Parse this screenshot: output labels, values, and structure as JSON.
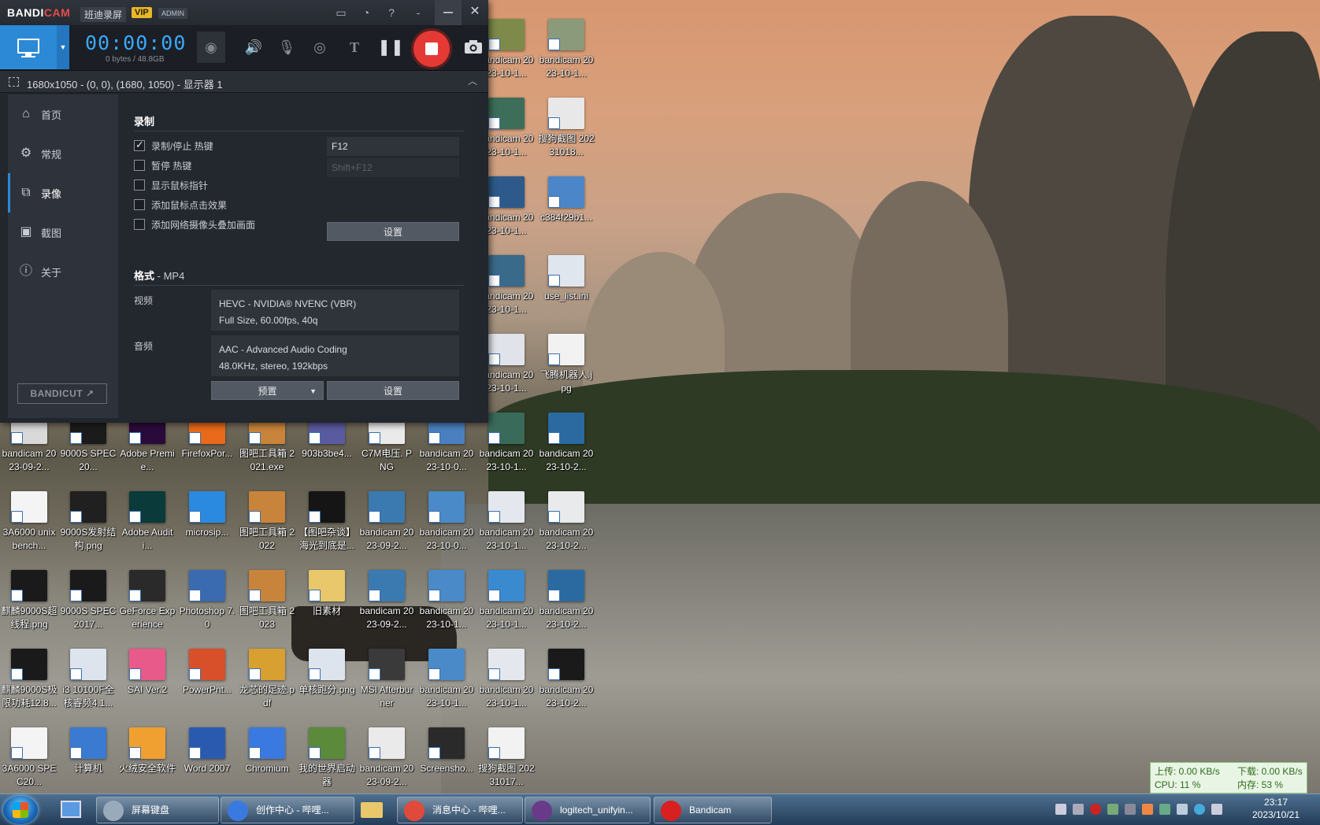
{
  "bandicam": {
    "logo_band": "BANDI",
    "logo_cam": "CAM",
    "brand_cn": "班迪录屏",
    "vip": "VIP",
    "admin": "ADMIN",
    "timer": "00:00:00",
    "bytes": "0 bytes / 48.8GB",
    "area": "1680x1050 - (0, 0), (1680, 1050) - 显示器 1",
    "sidebar": [
      "首页",
      "常规",
      "录像",
      "截图",
      "关于"
    ],
    "bandicut": "BANDICUT ↗",
    "record": {
      "title": "录制",
      "options": [
        {
          "label": "录制/停止 热键",
          "checked": true
        },
        {
          "label": "暂停 热键",
          "checked": false
        },
        {
          "label": "显示鼠标指针",
          "checked": false
        },
        {
          "label": "添加鼠标点击效果",
          "checked": false
        },
        {
          "label": "添加网络摄像头叠加画面",
          "checked": false
        }
      ],
      "hotkey_record": "F12",
      "hotkey_pause": "Shift+F12",
      "settings_btn": "设置"
    },
    "format": {
      "title": "格式",
      "container": " - MP4",
      "video_label": "视频",
      "video_line1": "HEVC - NVIDIA® NVENC (VBR)",
      "video_line2": "Full Size, 60.00fps, 40q",
      "audio_label": "音频",
      "audio_line1": "AAC - Advanced Audio Coding",
      "audio_line2": "48.0KHz, stereo, 192kbps",
      "preset_btn": "预置",
      "settings_btn": "设置"
    }
  },
  "desktop_icons": [
    {
      "label": "bandicam 2023-10-1...",
      "col": 8,
      "row": 0,
      "color": "#7d8a4a"
    },
    {
      "label": "bandicam 2023-10-1...",
      "col": 9,
      "row": 0,
      "color": "#8a9a7a"
    },
    {
      "label": "bandicam 2023-10-1...",
      "col": 8,
      "row": 1,
      "color": "#3d6e5a"
    },
    {
      "label": "搜狗截图 20231018...",
      "col": 9,
      "row": 1,
      "color": "#e8e8e8"
    },
    {
      "label": "bandicam 2023-10-1...",
      "col": 8,
      "row": 2,
      "color": "#2d5a8a"
    },
    {
      "label": "c384f29b1...",
      "col": 9,
      "row": 2,
      "color": "#4a86c8"
    },
    {
      "label": "bandicam 2023-10-1...",
      "col": 8,
      "row": 3,
      "color": "#3a6a8a"
    },
    {
      "label": "use_list.ini",
      "col": 9,
      "row": 3,
      "color": "#dfe6ee"
    },
    {
      "label": "bandicam 2023-10-1...",
      "col": 8,
      "row": 4,
      "color": "#e0e4ea"
    },
    {
      "label": "飞腾机器人.jpg",
      "col": 9,
      "row": 4,
      "color": "#f2f2f2"
    },
    {
      "label": "bandicam 2023-09-2...",
      "col": 0,
      "row": 5,
      "color": "#d9d9d9"
    },
    {
      "label": "9000S SPEC20...",
      "col": 1,
      "row": 5,
      "color": "#1b1b1b"
    },
    {
      "label": "Adobe Premie...",
      "col": 2,
      "row": 5,
      "color": "#2a0a3a"
    },
    {
      "label": "FirefoxPor...",
      "col": 3,
      "row": 5,
      "color": "#e86a1a"
    },
    {
      "label": "图吧工具箱 2021.exe",
      "col": 4,
      "row": 5,
      "color": "#c8843a"
    },
    {
      "label": "903b3be4...",
      "col": 5,
      "row": 5,
      "color": "#5a5aa0"
    },
    {
      "label": "C7M电压. PNG",
      "col": 6,
      "row": 5,
      "color": "#eaeaea"
    },
    {
      "label": "bandicam 2023-10-0...",
      "col": 7,
      "row": 5,
      "color": "#4a80c0"
    },
    {
      "label": "bandicam 2023-10-1...",
      "col": 8,
      "row": 5,
      "color": "#3a6a5a"
    },
    {
      "label": "bandicam 2023-10-2...",
      "col": 9,
      "row": 5,
      "color": "#2a6aa0"
    },
    {
      "label": "3A6000 unixbench...",
      "col": 0,
      "row": 6,
      "color": "#f4f4f4"
    },
    {
      "label": "9000S发射结构.png",
      "col": 1,
      "row": 6,
      "color": "#202020"
    },
    {
      "label": "Adobe Auditi...",
      "col": 2,
      "row": 6,
      "color": "#0a3a3a"
    },
    {
      "label": "microsip...",
      "col": 3,
      "row": 6,
      "color": "#2a8ae0"
    },
    {
      "label": "图吧工具箱 2022",
      "col": 4,
      "row": 6,
      "color": "#c8843a"
    },
    {
      "label": "【图吧杂谈】海光到底是...",
      "col": 5,
      "row": 6,
      "color": "#151515"
    },
    {
      "label": "bandicam 2023-09-2...",
      "col": 6,
      "row": 6,
      "color": "#3a7ab0"
    },
    {
      "label": "bandicam 2023-10-0...",
      "col": 7,
      "row": 6,
      "color": "#4a8ac8"
    },
    {
      "label": "bandicam 2023-10-1...",
      "col": 8,
      "row": 6,
      "color": "#e4e8ee"
    },
    {
      "label": "bandicam 2023-10-2...",
      "col": 9,
      "row": 6,
      "color": "#e8eaec"
    },
    {
      "label": "麒麟9000S超线程.png",
      "col": 0,
      "row": 7,
      "color": "#1a1a1a"
    },
    {
      "label": "9000S SPEC2017...",
      "col": 1,
      "row": 7,
      "color": "#1a1a1a"
    },
    {
      "label": "GeForce Experience",
      "col": 2,
      "row": 7,
      "color": "#2a2a2a"
    },
    {
      "label": "Photoshop 7.0",
      "col": 3,
      "row": 7,
      "color": "#3a6ab0"
    },
    {
      "label": "图吧工具箱 2023",
      "col": 4,
      "row": 7,
      "color": "#c8843a"
    },
    {
      "label": "旧素材",
      "col": 5,
      "row": 7,
      "color": "#e8c86a"
    },
    {
      "label": "bandicam 2023-09-2...",
      "col": 6,
      "row": 7,
      "color": "#3a7ab0"
    },
    {
      "label": "bandicam 2023-10-1...",
      "col": 7,
      "row": 7,
      "color": "#4a8ac8"
    },
    {
      "label": "bandicam 2023-10-1...",
      "col": 8,
      "row": 7,
      "color": "#3a8ad0"
    },
    {
      "label": "bandicam 2023-10-2...",
      "col": 9,
      "row": 7,
      "color": "#2a6aa0"
    },
    {
      "label": "麒麟9000S极限功耗12.8...",
      "col": 0,
      "row": 8,
      "color": "#1a1a1a"
    },
    {
      "label": "i3 10100F全核睿频4.1...",
      "col": 1,
      "row": 8,
      "color": "#dde4ee"
    },
    {
      "label": "SAI Ver.2",
      "col": 2,
      "row": 8,
      "color": "#e85a8a"
    },
    {
      "label": "PowerPnt...",
      "col": 3,
      "row": 8,
      "color": "#d8502a"
    },
    {
      "label": "龙芯的足迹.pdf",
      "col": 4,
      "row": 8,
      "color": "#d8a030"
    },
    {
      "label": "单核跑分.png",
      "col": 5,
      "row": 8,
      "color": "#dde4ee"
    },
    {
      "label": "MSI Afterburner",
      "col": 6,
      "row": 8,
      "color": "#3a3a3a"
    },
    {
      "label": "bandicam 2023-10-1...",
      "col": 7,
      "row": 8,
      "color": "#4a8ac8"
    },
    {
      "label": "bandicam 2023-10-1...",
      "col": 8,
      "row": 8,
      "color": "#e4e8ee"
    },
    {
      "label": "bandicam 2023-10-2...",
      "col": 9,
      "row": 8,
      "color": "#1a1a1a"
    },
    {
      "label": "3A6000 SPEC20...",
      "col": 0,
      "row": 9,
      "color": "#f4f4f4"
    },
    {
      "label": "计算机",
      "col": 1,
      "row": 9,
      "color": "#3a7ad0"
    },
    {
      "label": "火绒安全软件",
      "col": 2,
      "row": 9,
      "color": "#f0a030"
    },
    {
      "label": "Word 2007",
      "col": 3,
      "row": 9,
      "color": "#2a5ab0"
    },
    {
      "label": "Chromium",
      "col": 4,
      "row": 9,
      "color": "#3a7ae0"
    },
    {
      "label": "我的世界启动器",
      "col": 5,
      "row": 9,
      "color": "#5a8a3a"
    },
    {
      "label": "bandicam 2023-09-2...",
      "col": 6,
      "row": 9,
      "color": "#eaeaea"
    },
    {
      "label": "Screensho...",
      "col": 7,
      "row": 9,
      "color": "#2a2a2a"
    },
    {
      "label": "搜狗截图 20231017...",
      "col": 8,
      "row": 9,
      "color": "#f2f2f2"
    }
  ],
  "taskbar": {
    "tasks": [
      {
        "label": "屏幕键盘",
        "color": "#9ab"
      },
      {
        "label": "创作中心 - 哔哩...",
        "color": "#3a7ae0"
      },
      {
        "label": "消息中心 - 哔哩...",
        "color": "#e04a3a"
      },
      {
        "label": "logitech_unifyin...",
        "color": "#6a3a8a"
      },
      {
        "label": "Bandicam",
        "color": "#d82020"
      }
    ],
    "clock_time": "23:17",
    "clock_date": "2023/10/21"
  },
  "net": {
    "upload": "上传: 0.00 KB/s",
    "download": "下载: 0.00 KB/s",
    "cpu": "CPU: 11 %",
    "mem": "内存: 53 %"
  }
}
